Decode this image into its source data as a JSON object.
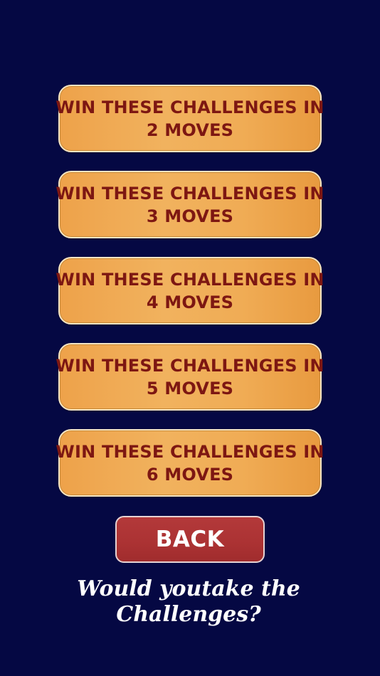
{
  "colors": {
    "background": "#050843",
    "challenge_button": "#f0ac55",
    "challenge_text": "#7d1712",
    "back_button": "#ab3233",
    "text_white": "#ffffff"
  },
  "challenges": [
    {
      "line1": "WIN THESE CHALLENGES IN",
      "line2": "2 MOVES"
    },
    {
      "line1": "WIN THESE CHALLENGES IN",
      "line2": "3 MOVES"
    },
    {
      "line1": "WIN THESE CHALLENGES IN",
      "line2": "4 MOVES"
    },
    {
      "line1": "WIN THESE CHALLENGES IN",
      "line2": "5 MOVES"
    },
    {
      "line1": "WIN THESE CHALLENGES IN",
      "line2": "6 MOVES"
    }
  ],
  "back": {
    "label": "BACK"
  },
  "tagline": {
    "line1": "Would youtake the",
    "line2": "Challenges?"
  }
}
